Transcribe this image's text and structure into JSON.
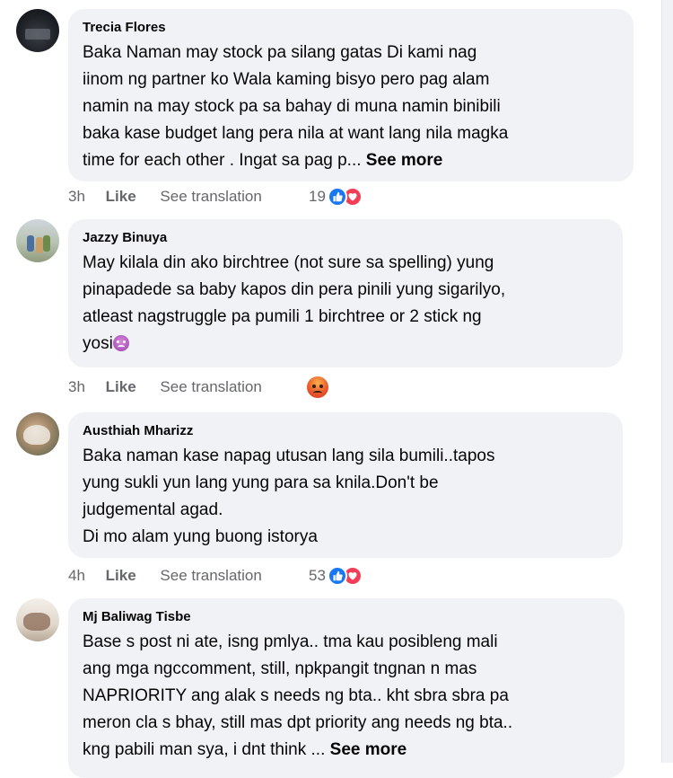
{
  "comments": [
    {
      "author": "Trecia Flores",
      "text": "Baka Naman may stock pa silang gatas Di kami nag\niinom ng partner ko Wala kaming bisyo pero pag alam\nnamin na may stock pa sa bahay di muna namin binibili\nbaka kase budget lang pera nila at want lang nila magka\ntime for each other . Ingat sa pag p... ",
      "see_more": "See more",
      "time": "3h",
      "like": "Like",
      "translate": "See translation",
      "reaction_count": "19",
      "reaction_icons": [
        "like-icon",
        "love-icon"
      ]
    },
    {
      "author": "Jazzy Binuya",
      "text": "May kilala din ako birchtree (not sure sa spelling) yung\npinapadede sa baby kapos din pera pinili yung sigarilyo,\natleast nagstruggle pa pumili 1 birchtree or 2 stick ng\nyosi",
      "time": "3h",
      "like": "Like",
      "translate": "See translation",
      "reaction_icons": [
        "angry-icon"
      ]
    },
    {
      "author": "Austhiah Mharizz",
      "text": "Baka naman kase napag utusan lang sila bumili..tapos\nyung sukli yun lang yung para sa knila.Don't be\njudgemental agad.\nDi mo alam yung buong istorya",
      "time": "4h",
      "like": "Like",
      "translate": "See translation",
      "reaction_count": "53",
      "reaction_icons": [
        "like-icon",
        "love-icon"
      ]
    },
    {
      "author": "Mj Baliwag Tisbe",
      "text": "Base s post ni ate, isng pmlya.. tma kau posibleng mali\nang mga ngccomment, still, npkpangit tngnan n mas\nNAPRIORITY ang alak s needs ng bta.. kht sbra sbra pa\nmeron cla s bhay, still mas dpt priority ang needs ng bta..\nkng pabili man sya, i dnt think ... ",
      "see_more": "See more"
    }
  ]
}
